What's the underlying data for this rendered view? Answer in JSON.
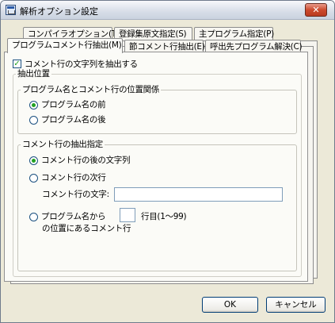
{
  "window": {
    "title": "解析オプション設定",
    "close_label": "✕"
  },
  "tabs_back": [
    {
      "label": "コンパイラオプション(T)"
    },
    {
      "label": "登録集原文指定(S)"
    },
    {
      "label": "主プログラム指定(P)"
    }
  ],
  "tabs_front": [
    {
      "label": "プログラムコメント行抽出(M)",
      "active": true
    },
    {
      "label": "節コメント行抽出(E)",
      "active": false
    },
    {
      "label": "呼出先プログラム解決(C)",
      "active": false
    }
  ],
  "panel": {
    "extract_checkbox": {
      "label": "コメント行の文字列を抽出する",
      "checked": true,
      "mark": "✓"
    },
    "extract_position": {
      "legend": "抽出位置",
      "relation_group": {
        "legend": "プログラム名とコメント行の位置関係",
        "options": [
          {
            "label": "プログラム名の前",
            "checked": true
          },
          {
            "label": "プログラム名の後",
            "checked": false
          }
        ]
      },
      "comment_group": {
        "legend": "コメント行の抽出指定",
        "option_after_string": {
          "label": "コメント行の後の文字列",
          "checked": true
        },
        "option_next_line": {
          "label": "コメント行の次行",
          "checked": false
        },
        "comment_string_label": "コメント行の文字:",
        "comment_string_value": "",
        "option_from_program": {
          "label": "プログラム名から",
          "checked": false,
          "line_value": "",
          "line_suffix": "行目(1〜99)",
          "second_line": "の位置にあるコメント行"
        }
      }
    }
  },
  "buttons": {
    "ok": "OK",
    "cancel": "キャンセル"
  },
  "colors": {
    "window_bg": "#ece9d8",
    "panel_bg": "#fbfbf7",
    "check_green": "#21a121",
    "close_red": "#cc4a2e"
  }
}
